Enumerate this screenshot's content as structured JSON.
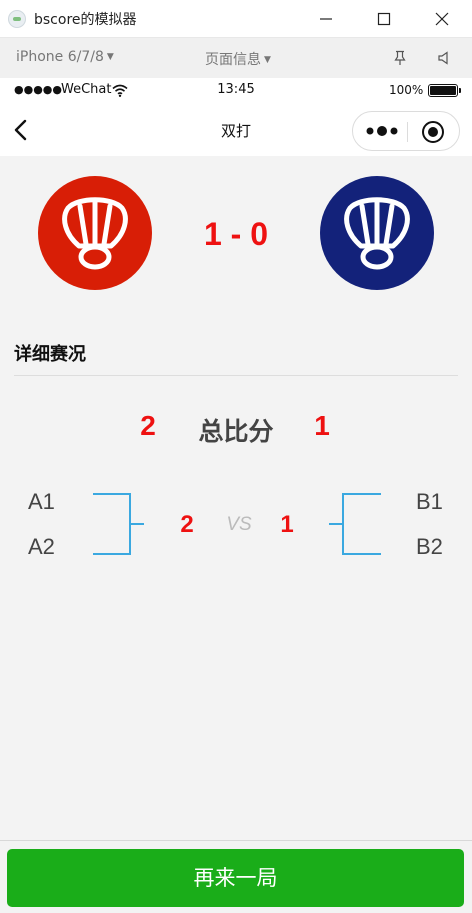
{
  "window": {
    "title": "bscore的模拟器",
    "minimize_icon": "minimize-icon",
    "maximize_icon": "maximize-icon",
    "close_icon": "close-icon"
  },
  "simulator": {
    "device": "iPhone 6/7/8",
    "page_info": "页面信息",
    "pin_icon": "pin-icon",
    "sound_icon": "speaker-icon"
  },
  "status_bar": {
    "signal": "●●●●●",
    "carrier": "WeChat",
    "time": "13:45",
    "battery": "100%"
  },
  "nav": {
    "title": "双打",
    "back_icon": "back-chevron-icon",
    "more_icon": "more-dots-icon",
    "close_icon": "target-close-icon"
  },
  "match": {
    "team_a_color": "#d81e06",
    "team_b_color": "#13227a",
    "logo_icon": "shuttlecock-icon",
    "score": "1 - 0"
  },
  "details": {
    "title": "详细赛况",
    "total_label": "总比分",
    "total_a": "2",
    "total_b": "1",
    "players_a": [
      "A1",
      "A2"
    ],
    "players_b": [
      "B1",
      "B2"
    ],
    "game_a": "2",
    "game_b": "1",
    "vs": "VS",
    "bracket_color": "#3aa8e0",
    "score_color": "#ee1111"
  },
  "actions": {
    "play_again": "再来一局",
    "button_color": "#1aad19"
  }
}
